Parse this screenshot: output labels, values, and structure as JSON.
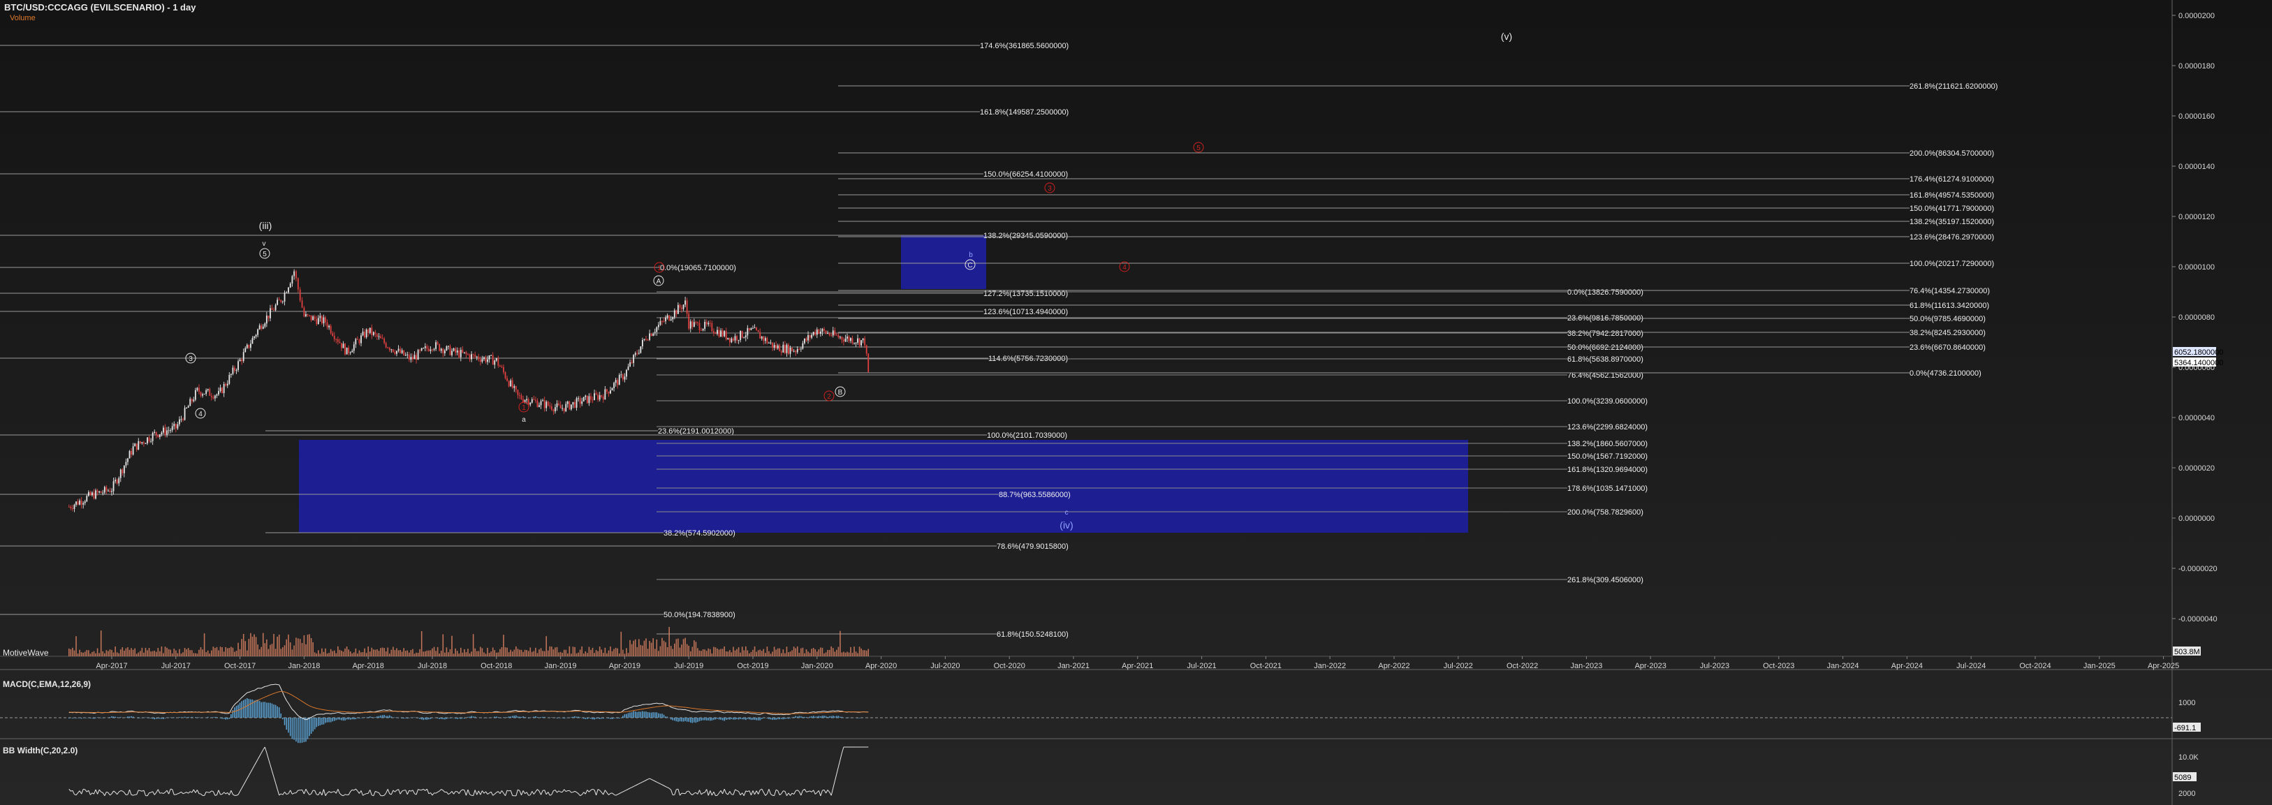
{
  "chart_data": {
    "type": "line",
    "title": "BTC/USD:CCCAGG (EVILSCENARIO) - 1 day",
    "price_type": "candlestick",
    "log_scale": true,
    "volume_label": "Volume",
    "x_ticks": [
      "Apr-2017",
      "Jul-2017",
      "Oct-2017",
      "Jan-2018",
      "Apr-2018",
      "Jul-2018",
      "Oct-2018",
      "Jan-2019",
      "Apr-2019",
      "Jul-2019",
      "Oct-2019",
      "Jan-2020",
      "Apr-2020",
      "Jul-2020",
      "Oct-2020",
      "Jan-2021",
      "Apr-2021",
      "Jul-2021",
      "Oct-2021",
      "Jan-2022",
      "Apr-2022",
      "Jul-2022",
      "Oct-2022",
      "Jan-2023",
      "Apr-2023",
      "Jul-2023",
      "Oct-2023",
      "Jan-2024",
      "Apr-2024",
      "Jul-2024",
      "Oct-2024",
      "Jan-2025",
      "Apr-2025"
    ],
    "y_ticks": [
      "0.0000200",
      "0.0000180",
      "0.0000160",
      "0.0000140",
      "0.0000120",
      "0.0000100",
      "0.0000080",
      "0.0000060",
      "0.0000040",
      "0.0000020",
      "0.0000000",
      "-0.0000020",
      "-0.0000040"
    ],
    "price_badges": [
      "6052.1800000",
      "5364.1400000"
    ],
    "volume_badge": "503.8M",
    "price_series": [
      {
        "date": "2017-02",
        "close": 1000
      },
      {
        "date": "2017-03",
        "close": 1150
      },
      {
        "date": "2017-04",
        "close": 1250
      },
      {
        "date": "2017-05",
        "close": 2100
      },
      {
        "date": "2017-06",
        "close": 2500
      },
      {
        "date": "2017-07",
        "close": 2700
      },
      {
        "date": "2017-08",
        "close": 4300
      },
      {
        "date": "2017-09",
        "close": 4100
      },
      {
        "date": "2017-10",
        "close": 6300
      },
      {
        "date": "2017-11",
        "close": 10000
      },
      {
        "date": "2017-12",
        "close": 14000
      },
      {
        "date": "2017-12-17",
        "close": 19500
      },
      {
        "date": "2018-01",
        "close": 11000
      },
      {
        "date": "2018-02",
        "close": 10300
      },
      {
        "date": "2018-03",
        "close": 7000
      },
      {
        "date": "2018-04",
        "close": 9200
      },
      {
        "date": "2018-05",
        "close": 7500
      },
      {
        "date": "2018-06",
        "close": 6400
      },
      {
        "date": "2018-07",
        "close": 7700
      },
      {
        "date": "2018-08",
        "close": 7000
      },
      {
        "date": "2018-09",
        "close": 6600
      },
      {
        "date": "2018-10",
        "close": 6300
      },
      {
        "date": "2018-11",
        "close": 4000
      },
      {
        "date": "2018-12",
        "close": 3700
      },
      {
        "date": "2019-01",
        "close": 3450
      },
      {
        "date": "2019-02",
        "close": 3800
      },
      {
        "date": "2019-03",
        "close": 4100
      },
      {
        "date": "2019-04",
        "close": 5300
      },
      {
        "date": "2019-05",
        "close": 8500
      },
      {
        "date": "2019-06",
        "close": 10800
      },
      {
        "date": "2019-06-26",
        "close": 13000
      },
      {
        "date": "2019-07",
        "close": 10000
      },
      {
        "date": "2019-08",
        "close": 9600
      },
      {
        "date": "2019-09",
        "close": 8300
      },
      {
        "date": "2019-10",
        "close": 9200
      },
      {
        "date": "2019-11",
        "close": 7500
      },
      {
        "date": "2019-12",
        "close": 7200
      },
      {
        "date": "2020-01",
        "close": 9300
      },
      {
        "date": "2020-02",
        "close": 8500
      },
      {
        "date": "2020-03-08",
        "close": 8000
      },
      {
        "date": "2020-03-13",
        "close": 5364
      }
    ],
    "fib_levels_left": [
      {
        "label": "174.6%(361865.5600000)"
      },
      {
        "label": "161.8%(149587.2500000)"
      },
      {
        "label": "150.0%(66254.4100000)"
      },
      {
        "label": "138.2%(29345.0590000)"
      },
      {
        "label": "0.0%(19065.7100000)"
      },
      {
        "label": "127.2%(13735.1510000)"
      },
      {
        "label": "123.6%(10713.4940000)"
      },
      {
        "label": "114.6%(5756.7230000)"
      },
      {
        "label": "23.6%(2191.0012000)"
      },
      {
        "label": "100.0%(2101.7039000)"
      },
      {
        "label": "88.7%(963.5586000)"
      },
      {
        "label": "38.2%(574.5902000)"
      },
      {
        "label": "78.6%(479.9015800)"
      },
      {
        "label": "50.0%(194.7838900)"
      },
      {
        "label": "61.8%(150.5248100)"
      }
    ],
    "fib_levels_mid": [
      {
        "label": "0.0%(13826.7590000)"
      },
      {
        "label": "23.6%(9816.7850000)"
      },
      {
        "label": "38.2%(7942.2817000)"
      },
      {
        "label": "50.0%(6692.2124000)"
      },
      {
        "label": "61.8%(5638.8970000)"
      },
      {
        "label": "76.4%(4562.1562000)"
      },
      {
        "label": "100.0%(3239.0600000)"
      },
      {
        "label": "123.6%(2299.6824000)"
      },
      {
        "label": "138.2%(1860.5607000)"
      },
      {
        "label": "150.0%(1567.7192000)"
      },
      {
        "label": "161.8%(1320.9694000)"
      },
      {
        "label": "178.6%(1035.1471000)"
      },
      {
        "label": "200.0%(758.7829600)"
      },
      {
        "label": "261.8%(309.4506000)"
      }
    ],
    "fib_levels_right": [
      {
        "label": "261.8%(211621.6200000)"
      },
      {
        "label": "200.0%(86304.5700000)"
      },
      {
        "label": "176.4%(61274.9100000)"
      },
      {
        "label": "161.8%(49574.5350000)"
      },
      {
        "label": "150.0%(41771.7900000)"
      },
      {
        "label": "138.2%(35197.1520000)"
      },
      {
        "label": "123.6%(28476.2970000)"
      },
      {
        "label": "100.0%(20217.7290000)"
      },
      {
        "label": "76.4%(14354.2730000)"
      },
      {
        "label": "61.8%(11613.3420000)"
      },
      {
        "label": "50.0%(9785.4690000)"
      },
      {
        "label": "38.2%(8245.2930000)"
      },
      {
        "label": "23.6%(6670.8640000)"
      },
      {
        "label": "0.0%(4736.2100000)"
      }
    ],
    "wave_labels": [
      {
        "label": "(iii)",
        "color": "#e8e8e8"
      },
      {
        "label": "v",
        "color": "#e8e8e8"
      },
      {
        "label": "5",
        "color": "#e8e8e8"
      },
      {
        "label": "3",
        "color": "#e8e8e8"
      },
      {
        "label": "4",
        "color": "#e8e8e8"
      },
      {
        "label": "a",
        "color": "#e8e8e8"
      },
      {
        "label": "1",
        "color": "#d02020"
      },
      {
        "label": "A",
        "color": "#e8e8e8"
      },
      {
        "label": "1",
        "color": "#d02020"
      },
      {
        "label": "B",
        "color": "#e8e8e8"
      },
      {
        "label": "2",
        "color": "#d02020"
      },
      {
        "label": "b",
        "color": "#8fa0ff"
      },
      {
        "label": "C",
        "color": "#e8e8e8"
      },
      {
        "label": "3",
        "color": "#d02020"
      },
      {
        "label": "4",
        "color": "#d02020"
      },
      {
        "label": "5",
        "color": "#d02020"
      },
      {
        "label": "(v)",
        "color": "#e8e8e8"
      },
      {
        "label": "c",
        "color": "#8fa0ff"
      },
      {
        "label": "(iv)",
        "color": "#8fa0ff"
      }
    ],
    "watermark": "MotiveWave",
    "macd": {
      "label": "MACD(C,EMA,12,26,9)",
      "ticks": [
        "1000"
      ],
      "badge": "-691.1"
    },
    "bbw": {
      "label": "BB Width(C,20,2.0)",
      "ticks": [
        "10.0K",
        "2000"
      ],
      "badge": "5089"
    },
    "colors": {
      "up": "#e8e8e8",
      "down": "#e04040",
      "volume": "#d98060",
      "macd": "#e8e8e8",
      "signal": "#e07a2a",
      "hist": "#5aa0d0",
      "box": "#1f1f9a",
      "badge": "#e8e8e8"
    }
  }
}
